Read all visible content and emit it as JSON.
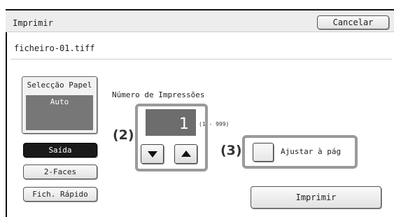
{
  "header": {
    "title": "Imprimir",
    "cancel_label": "Cancelar"
  },
  "file": {
    "name": "ficheiro-01.tiff"
  },
  "paper": {
    "label": "Selecção Papel",
    "value": "Auto"
  },
  "buttons": {
    "output": "Saída",
    "duplex": "2-Faces",
    "quick_file": "Fich. Rápido",
    "print": "Imprimir"
  },
  "copies": {
    "label": "Número de Impressões",
    "value": "1",
    "range": "(1 - 999)"
  },
  "fit": {
    "label": "Ajustar à pág"
  },
  "callouts": {
    "c2": "(2)",
    "c3": "(3)"
  },
  "icons": {
    "down": "arrow-down-icon",
    "up": "arrow-up-icon"
  }
}
